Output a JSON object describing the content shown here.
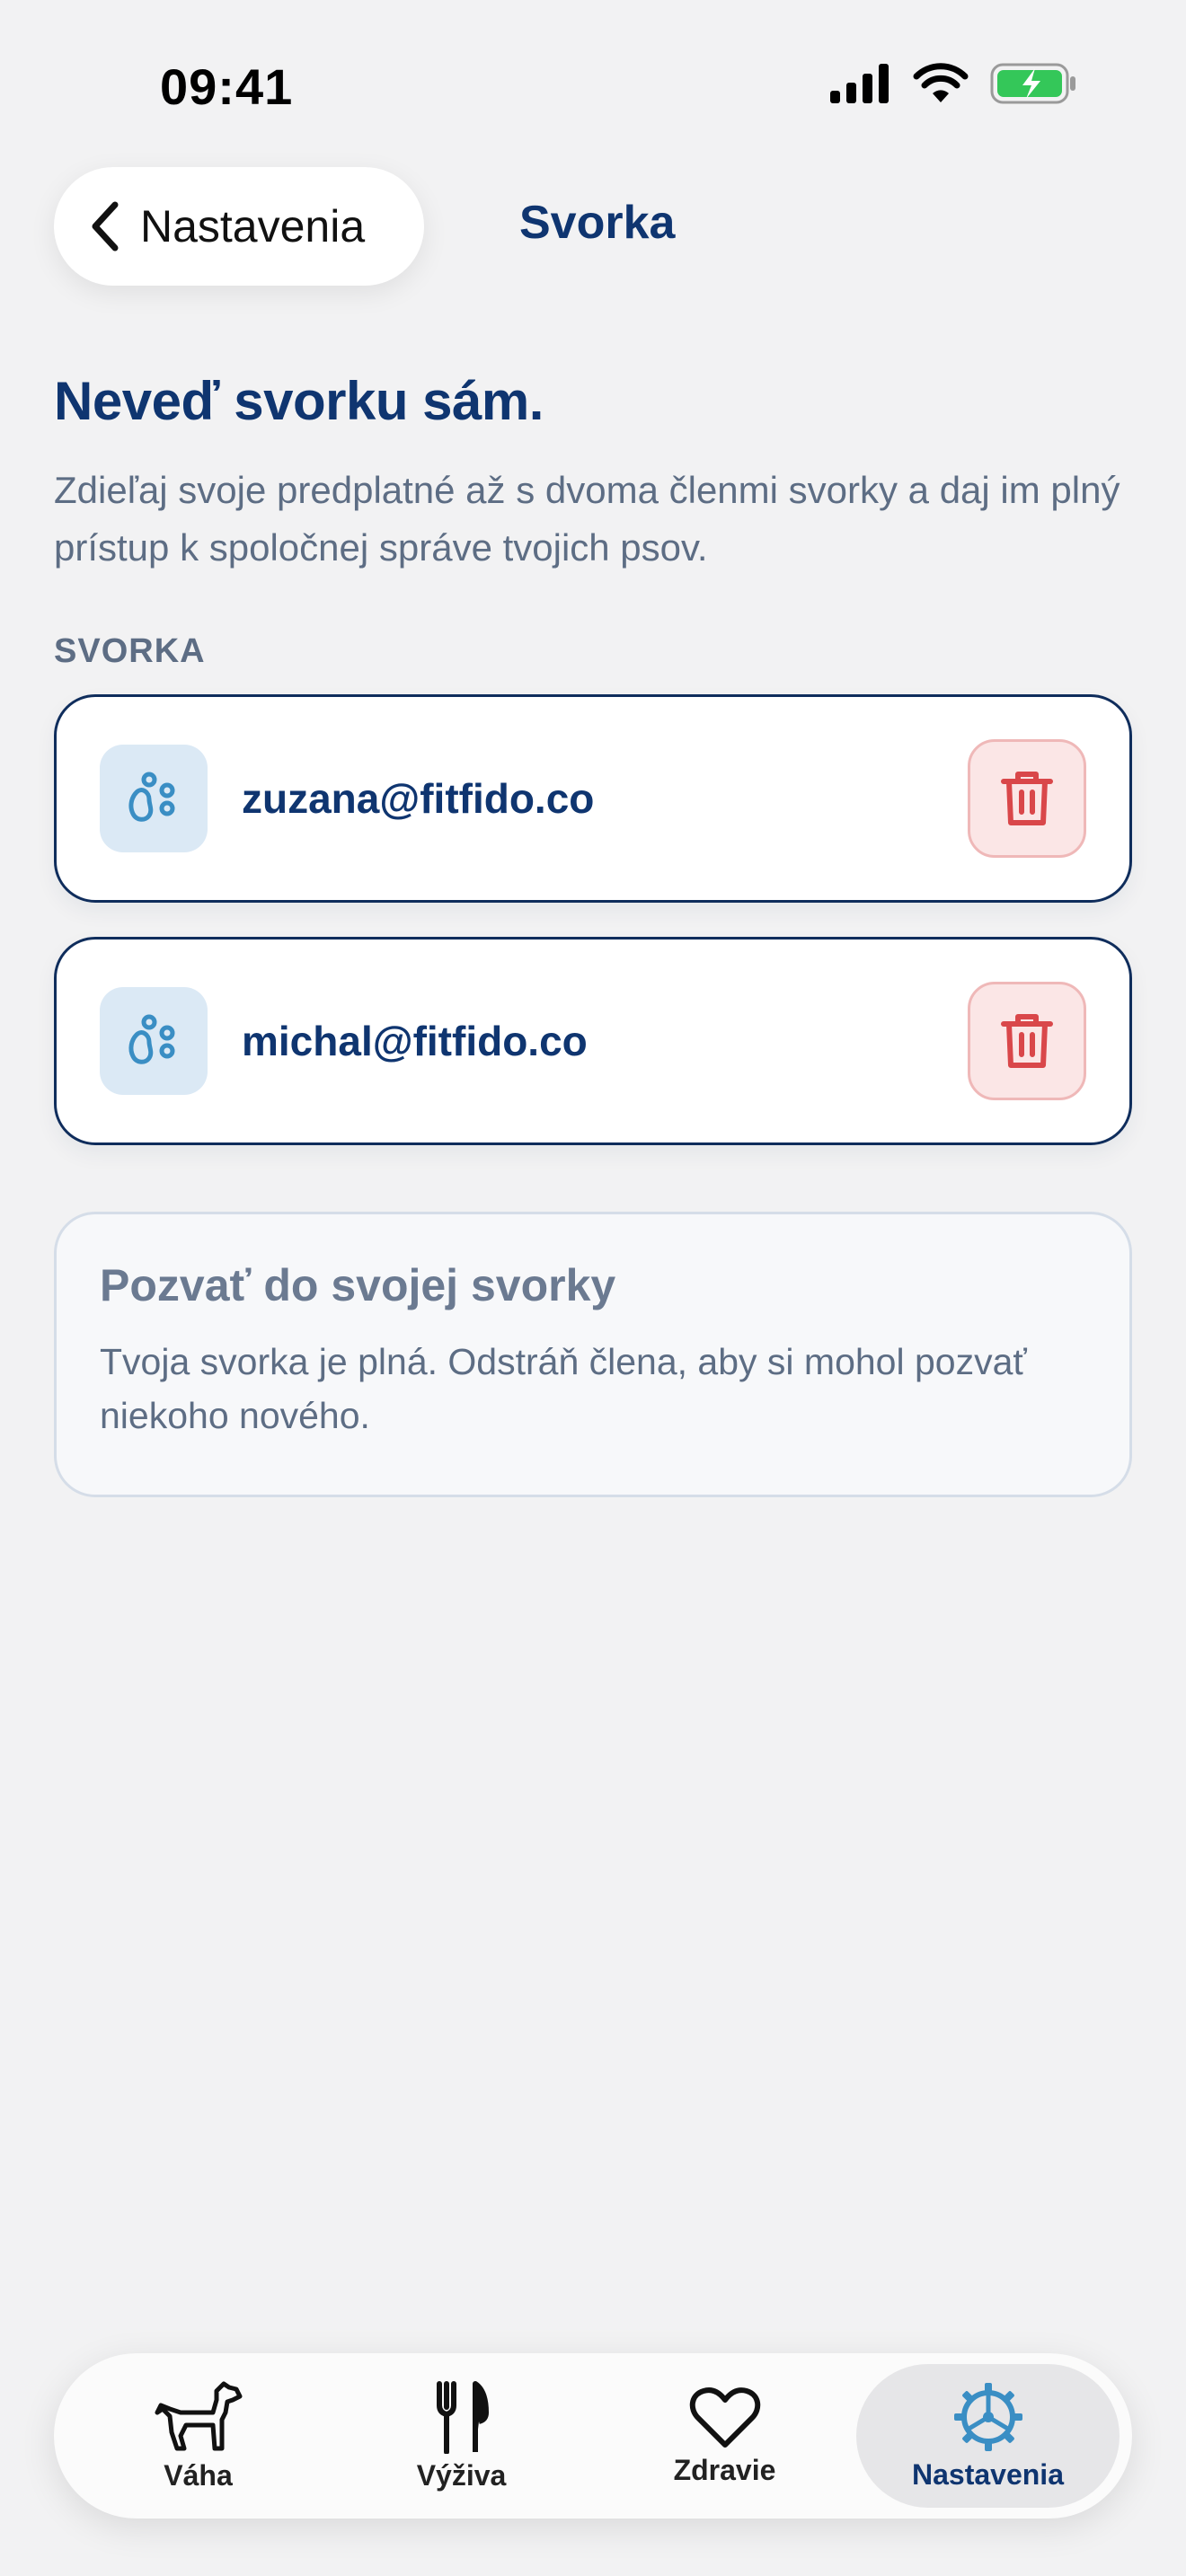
{
  "status_bar": {
    "time": "09:41"
  },
  "header": {
    "back_label": "Nastavenia",
    "title": "Svorka"
  },
  "intro": {
    "headline": "Neveď svorku sám.",
    "description": "Zdieľaj svoje predplatné až s dvoma členmi svorky a daj im plný prístup k spoločnej správe tvojich psov."
  },
  "section_label": "SVORKA",
  "members": [
    {
      "email": "zuzana@fitfido.co",
      "icon": "paw-icon"
    },
    {
      "email": "michal@fitfido.co",
      "icon": "paw-icon"
    }
  ],
  "invite": {
    "title": "Pozvať do svojej svorky",
    "text": "Tvoja svorka je plná. Odstráň člena, aby si mohol pozvať niekoho nového."
  },
  "tabs": [
    {
      "label": "Váha",
      "icon": "dog-icon"
    },
    {
      "label": "Výživa",
      "icon": "fork-knife-icon"
    },
    {
      "label": "Zdravie",
      "icon": "heart-icon"
    },
    {
      "label": "Nastavenia",
      "icon": "gear-icon",
      "active": true
    }
  ],
  "colors": {
    "accent": "#0f3570",
    "danger": "#d9474a",
    "paw": "#3a8ec4",
    "battery": "#34c759"
  }
}
